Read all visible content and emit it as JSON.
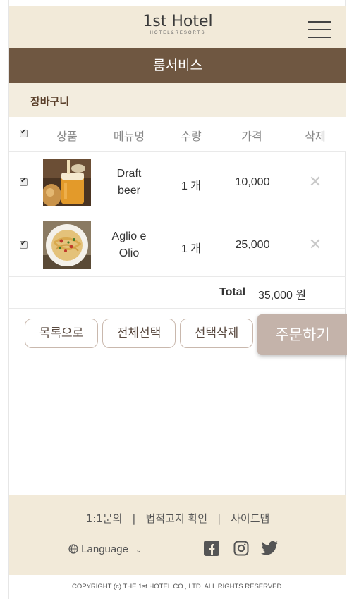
{
  "header": {
    "logo_title": "1st Hotel",
    "logo_sub": "HOTEL&RESORTS"
  },
  "page": {
    "title": "룸서비스",
    "section": "장바구니"
  },
  "columns": [
    "상품",
    "메뉴명",
    "수량",
    "가격",
    "삭제"
  ],
  "items": [
    {
      "name_l1": "Draft",
      "name_l2": "beer",
      "qty": "1 개",
      "price": "10,000",
      "checked": true,
      "delete_icon": "close-icon"
    },
    {
      "name_l1": "Aglio e",
      "name_l2": "Olio",
      "qty": "1 개",
      "price": "25,000",
      "checked": true,
      "delete_icon": "close-icon"
    }
  ],
  "total": {
    "label": "Total",
    "value": "35,000 원"
  },
  "buttons": {
    "list": "목록으로",
    "select_all": "전체선택",
    "delete_selected": "선택삭제",
    "order": "주문하기"
  },
  "footer": {
    "links": [
      "1:1문의",
      "법적고지 확인",
      "사이트맵"
    ],
    "language": "Language",
    "social": [
      "facebook-icon",
      "instagram-icon",
      "twitter-icon"
    ],
    "copyright": "COPYRIGHT (c) THE 1st HOTEL CO., LTD. ALL RIGHTS RESERVED."
  },
  "colors": {
    "cream": "#f2ead9",
    "brown": "#6f5741",
    "order": "#c4b3aa"
  }
}
